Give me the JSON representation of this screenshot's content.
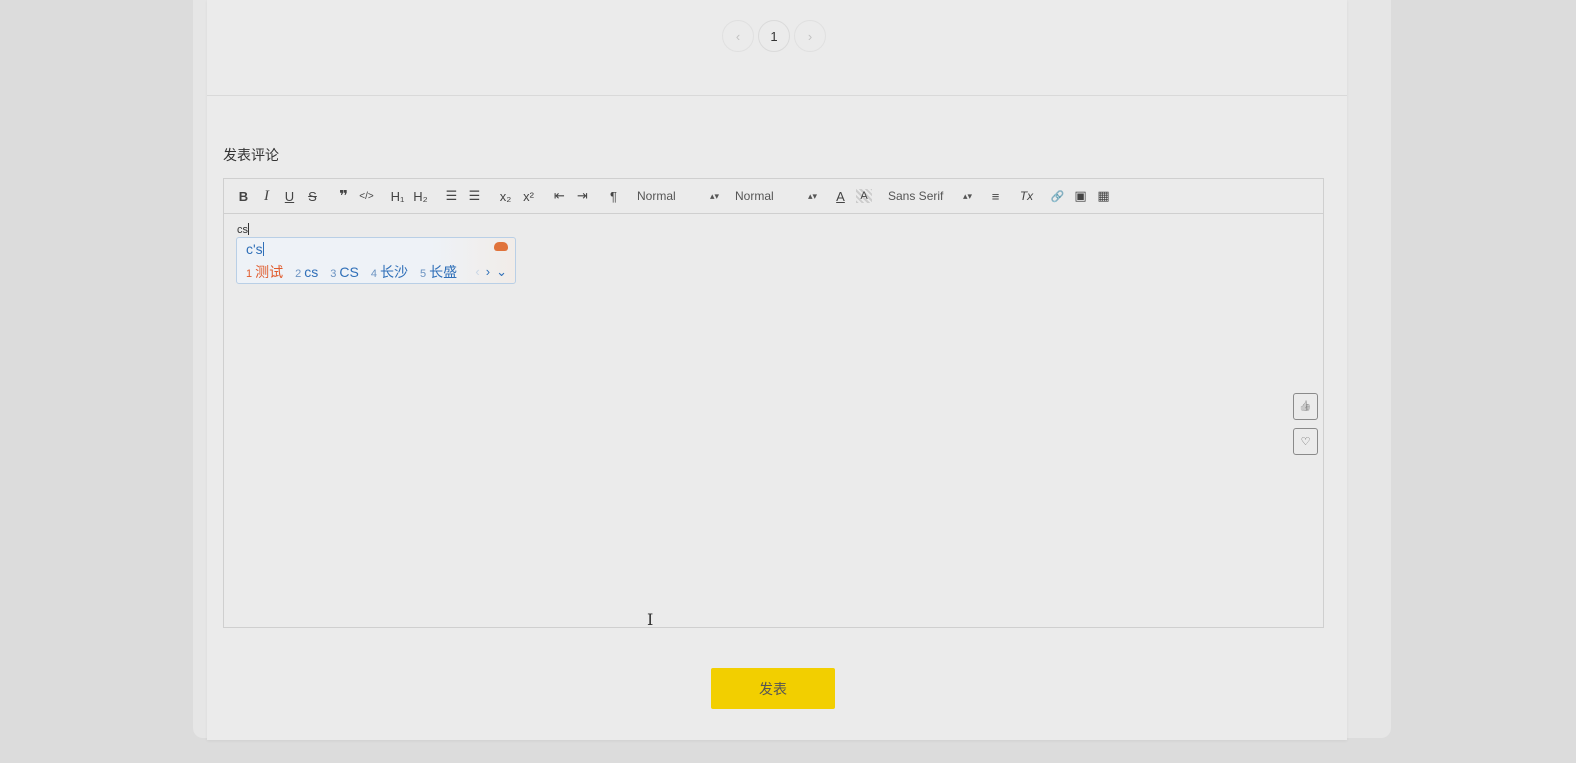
{
  "pagination": {
    "prev": "‹",
    "current": "1",
    "next": "›"
  },
  "comment": {
    "title": "发表评论",
    "typed_text": "cs"
  },
  "toolbar": {
    "bold": "B",
    "italic": "I",
    "underline": "U",
    "strike": "S",
    "blockquote": "❞",
    "code": "</>",
    "h1": "H₁",
    "h2": "H₂",
    "ordered_list": "☰",
    "bullet_list": "☰",
    "subscript": "x₂",
    "superscript": "x²",
    "outdent": "⇤",
    "indent": "⇥",
    "direction": "¶",
    "size_picker": "Normal",
    "header_picker": "Normal",
    "font_picker": "Sans Serif",
    "color": "A",
    "background": "A",
    "align": "≡",
    "clean": "Tx",
    "link": "🔗",
    "image": "▣",
    "video": "▦"
  },
  "ime": {
    "composing": "c's",
    "candidates": [
      {
        "num": "1",
        "text": "测试"
      },
      {
        "num": "2",
        "text": "cs"
      },
      {
        "num": "3",
        "text": "CS"
      },
      {
        "num": "4",
        "text": "长沙"
      },
      {
        "num": "5",
        "text": "长盛"
      }
    ],
    "prev": "‹",
    "next": "›",
    "expand": "⌄"
  },
  "side_actions": {
    "like_icon": "👍",
    "favorite_icon": "♡"
  },
  "submit_label": "发表",
  "colors": {
    "accent": "#f2cf00",
    "ime_text": "#2f6fb8",
    "ime_highlight": "#e05a2b"
  }
}
